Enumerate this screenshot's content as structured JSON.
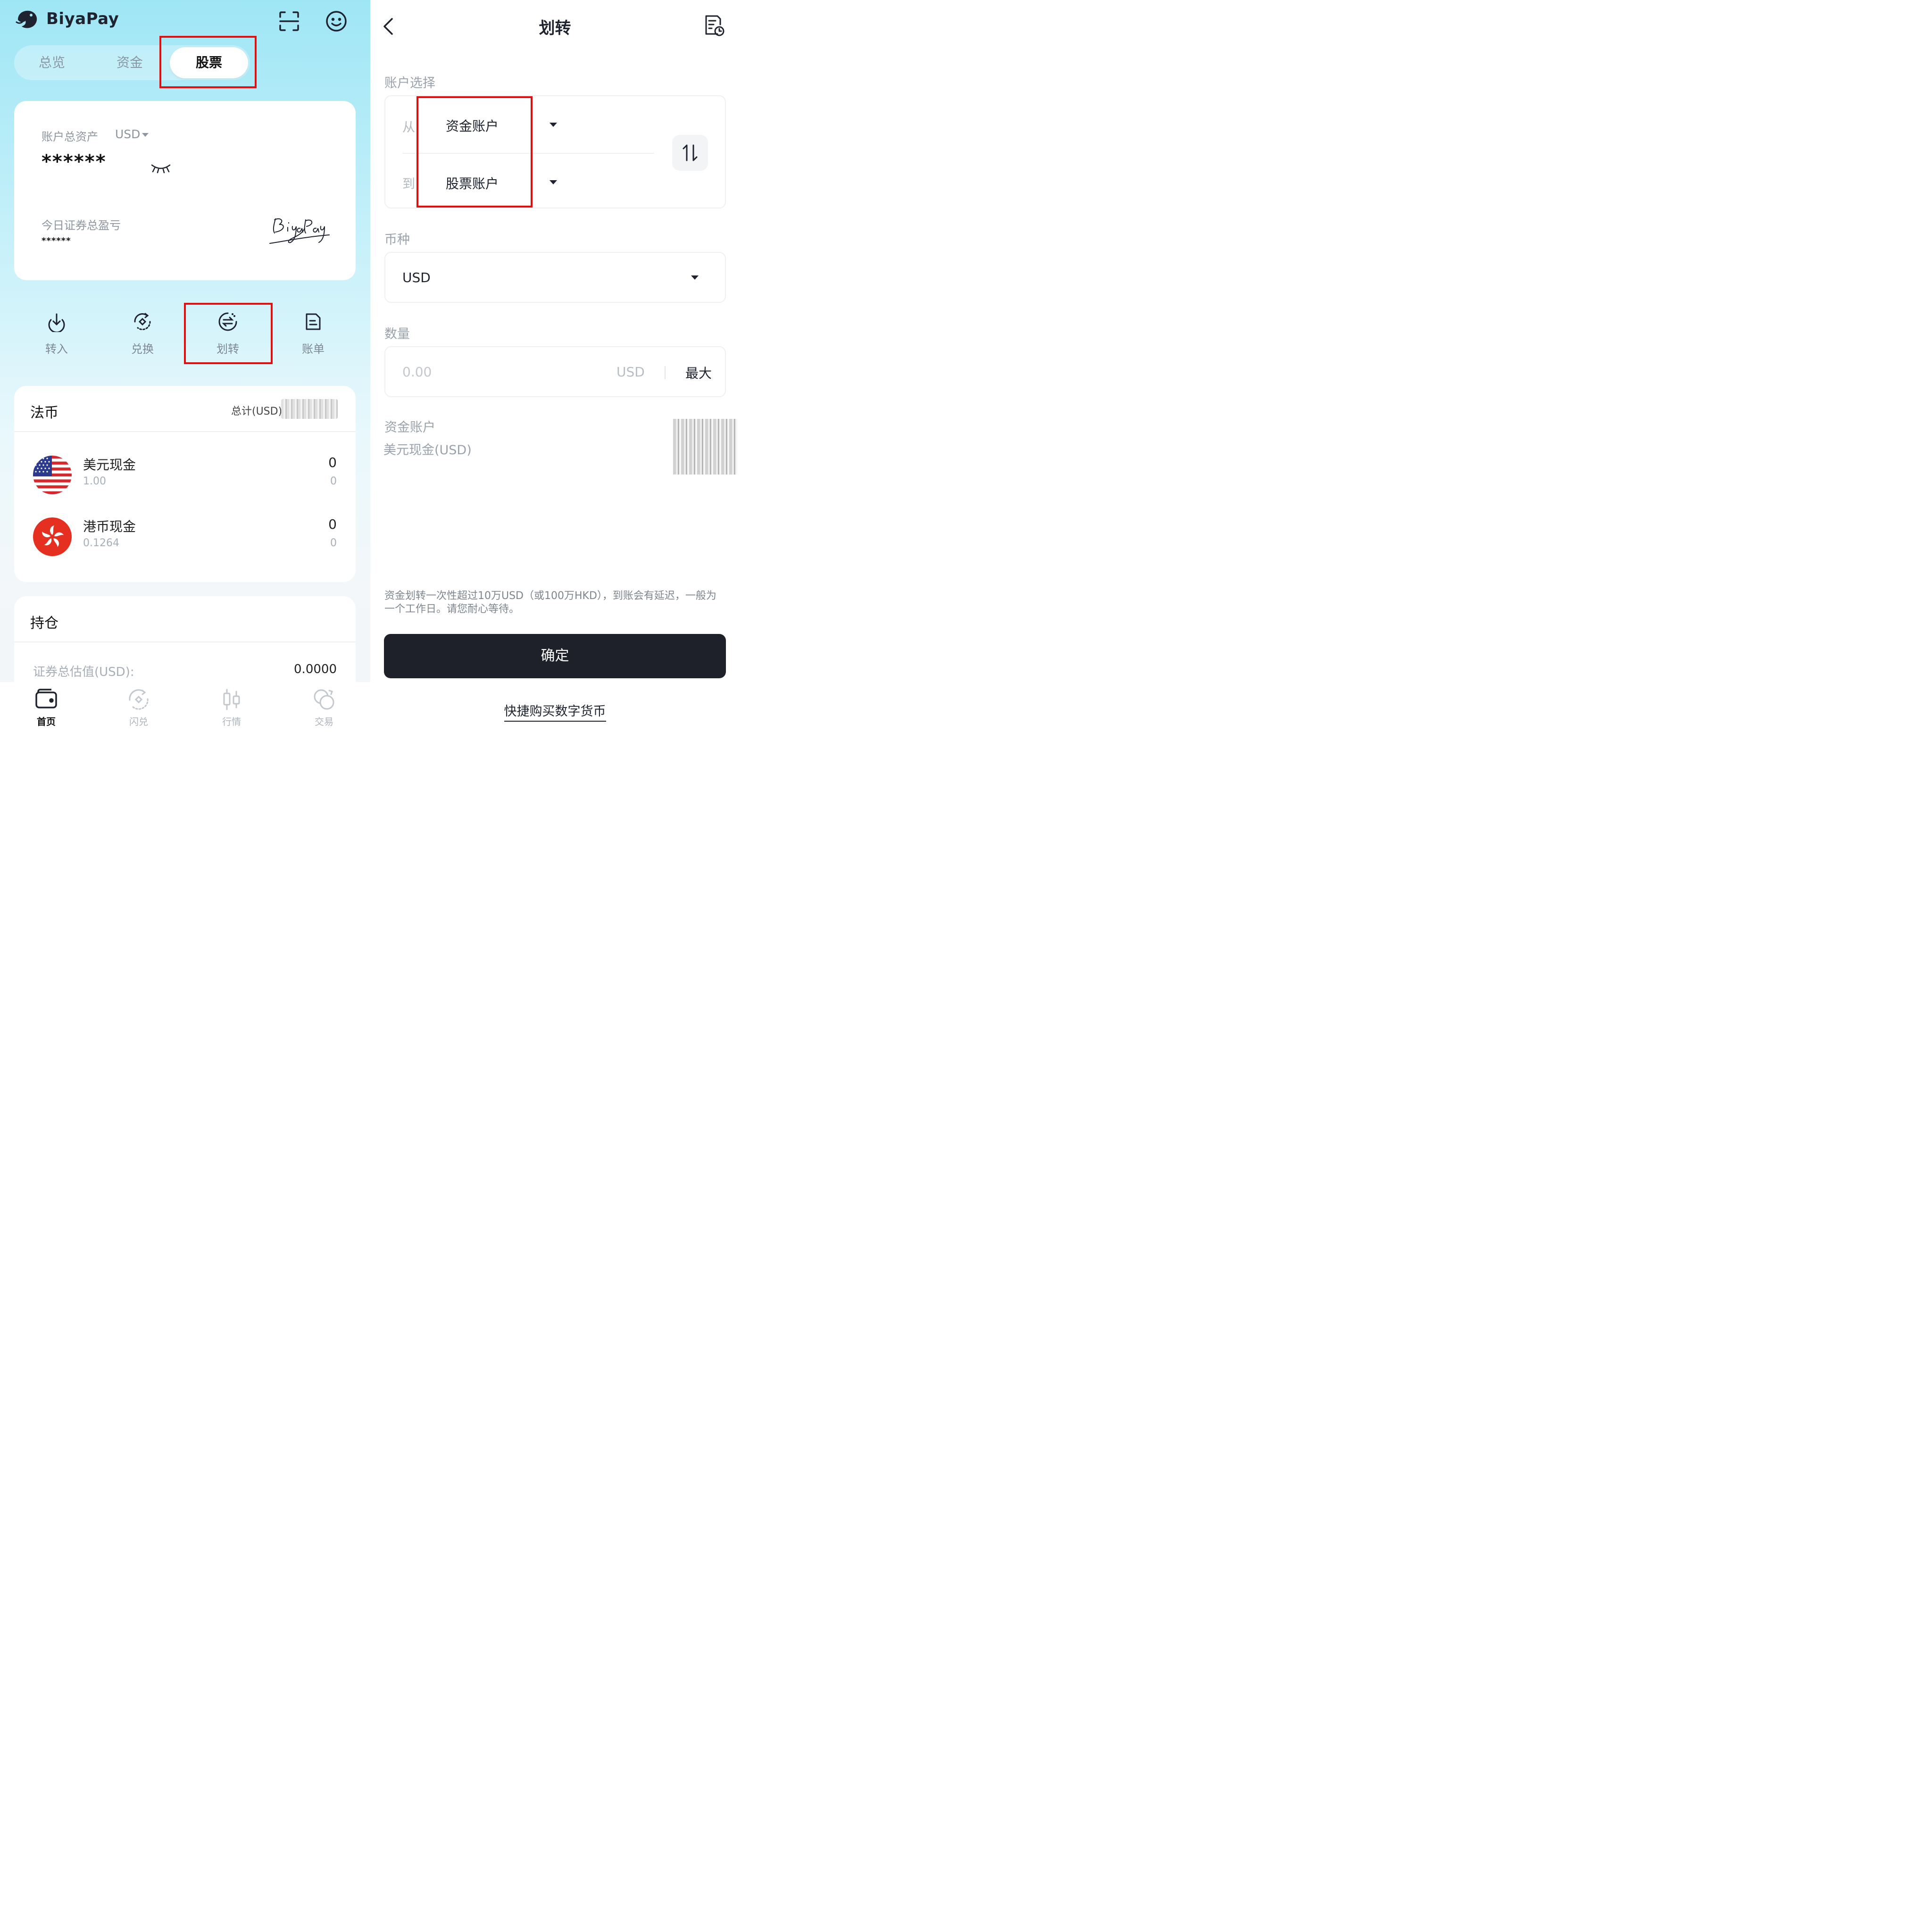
{
  "left": {
    "brand": "BiyaPay",
    "tabs": [
      "总览",
      "资金",
      "股票"
    ],
    "active_tab": "股票",
    "asset_card": {
      "total_label": "账户总资产",
      "currency": "USD",
      "masked_total": "******",
      "pnl_label": "今日证券总盈亏",
      "masked_pnl": "******",
      "signature": "BiyaPay"
    },
    "actions": [
      "转入",
      "兑换",
      "划转",
      "账单"
    ],
    "fiat": {
      "title": "法币",
      "total_label": "总计(USD)",
      "rows": [
        {
          "name": "美元现金",
          "rate": "1.00",
          "amount": "0",
          "sub": "0"
        },
        {
          "name": "港币现金",
          "rate": "0.1264",
          "amount": "0",
          "sub": "0"
        }
      ]
    },
    "holdings": {
      "title": "持仓",
      "value_label": "证券总估值(USD):",
      "value": "0.0000"
    },
    "bottom_nav": [
      "首页",
      "闪兑",
      "行情",
      "交易"
    ],
    "active_nav": "首页"
  },
  "right": {
    "title": "划转",
    "account_select_label": "账户选择",
    "from_label": "从",
    "from_value": "资金账户",
    "to_label": "到",
    "to_value": "股票账户",
    "currency_label": "币种",
    "currency_value": "USD",
    "amount_label": "数量",
    "amount_placeholder": "0.00",
    "amount_unit": "USD",
    "max_label": "最大",
    "source_account": "资金账户",
    "source_sub": "美元现金(USD)",
    "note": "资金划转一次性超过10万USD（或100万HKD），到账会有延迟，一般为一个工作日。请您耐心等待。",
    "confirm_label": "确定",
    "quick_buy_label": "快捷购买数字货币"
  },
  "colors": {
    "highlight_red": "#e01010",
    "confirm_bg": "#1e212a",
    "gradient_top": "#9fe6f5"
  }
}
